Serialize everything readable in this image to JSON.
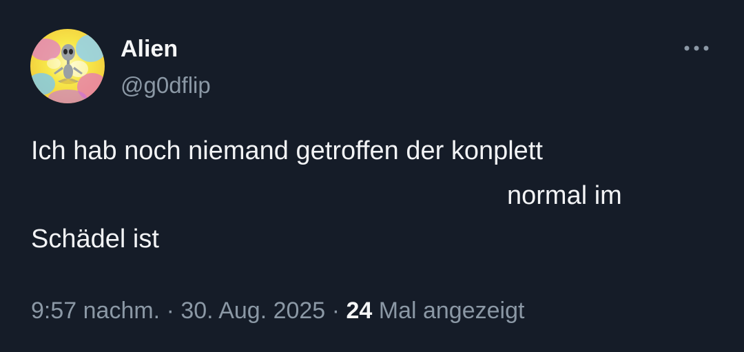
{
  "author": {
    "display_name": "Alien",
    "handle": "@g0dflip",
    "avatar_icon": "alien-figure-avatar"
  },
  "more_icon": "more-horizontal-icon",
  "post": {
    "lines": [
      "Ich hab noch niemand getroffen der konplett",
      "normal im",
      "Schädel ist"
    ]
  },
  "meta": {
    "time": "9:57 nachm.",
    "separator": "·",
    "date": "30. Aug. 2025",
    "views_count": "24",
    "views_label": "Mal angezeigt"
  },
  "colors": {
    "background": "#151c28",
    "text": "#f2f3f5",
    "secondary": "#8b98a5"
  }
}
